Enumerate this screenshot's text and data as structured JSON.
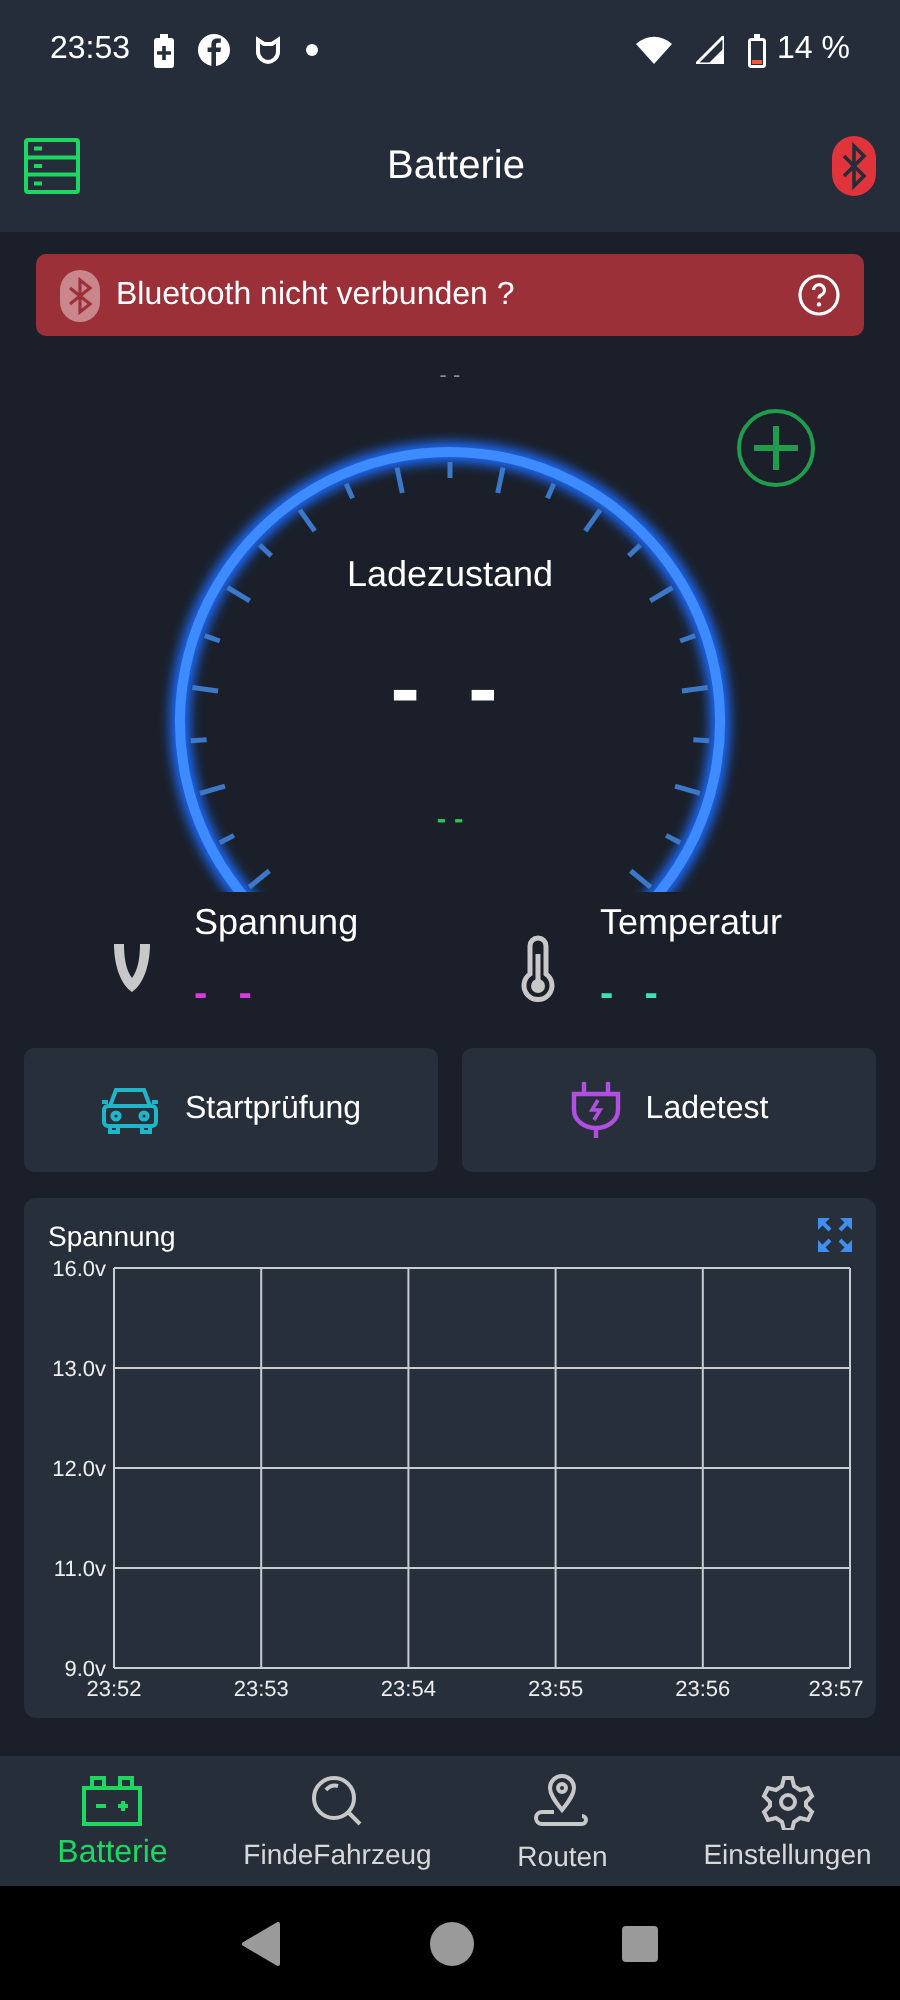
{
  "status_bar": {
    "time": "23:53",
    "battery_percent": "14 %"
  },
  "app_bar": {
    "title": "Batterie"
  },
  "alert": {
    "text": "Bluetooth nicht verbunden ?"
  },
  "gauge": {
    "top_reading": "- -",
    "label": "Ladezustand",
    "value": "- -",
    "sub_value": "- -"
  },
  "readings": [
    {
      "kind": "voltage",
      "label": "Spannung",
      "value": "- -",
      "color": "#d63ee0"
    },
    {
      "kind": "temperature",
      "label": "Temperatur",
      "value": "- -",
      "color": "#3ee0b8"
    }
  ],
  "actions": [
    {
      "kind": "car",
      "label": "Startprüfung"
    },
    {
      "kind": "plug",
      "label": "Ladetest"
    }
  ],
  "chart": {
    "title": "Spannung",
    "y_axis_labels": [
      "16.0v",
      "13.0v",
      "12.0v",
      "11.0v",
      "9.0v"
    ],
    "x_axis_labels": [
      "23:52",
      "23:53",
      "23:54",
      "23:55",
      "23:56",
      "23:57"
    ]
  },
  "bottom_nav": [
    {
      "kind": "battery",
      "label": "Batterie",
      "selected": true
    },
    {
      "kind": "search",
      "label": "FindeFahrzeug",
      "selected": false
    },
    {
      "kind": "route",
      "label": "Routen",
      "selected": false
    },
    {
      "kind": "settings",
      "label": "Einstellungen",
      "selected": false
    }
  ]
}
